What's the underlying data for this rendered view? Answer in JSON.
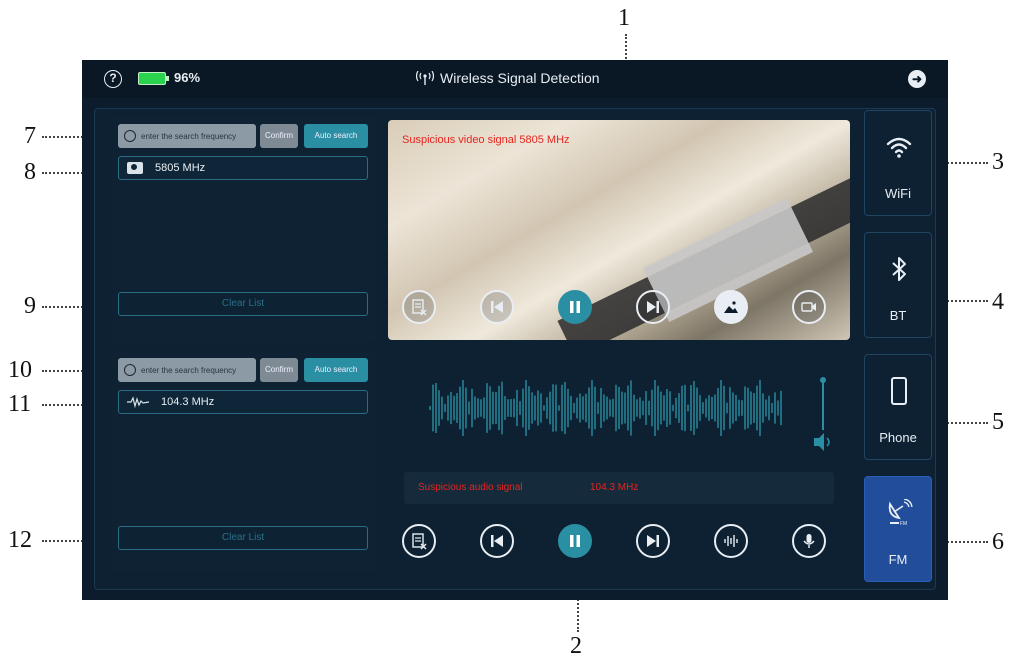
{
  "callouts": [
    "1",
    "2",
    "3",
    "4",
    "5",
    "6",
    "7",
    "8",
    "9",
    "10",
    "11",
    "12"
  ],
  "statusbar": {
    "help_glyph": "?",
    "battery_text": "96%",
    "title": "Wireless Signal Detection",
    "exit_glyph": "➜"
  },
  "video_list": {
    "search_placeholder": "enter the search frequency",
    "confirm_label": "Confirm",
    "auto_search_label": "Auto search",
    "entries": [
      {
        "frequency": "5805 MHz"
      }
    ],
    "clear_label": "Clear List"
  },
  "audio_list": {
    "search_placeholder": "enter the search frequency",
    "confirm_label": "Confirm",
    "auto_search_label": "Auto search",
    "entries": [
      {
        "frequency": "104.3 MHz"
      }
    ],
    "clear_label": "Clear List"
  },
  "video_view": {
    "alert_text": "Suspicious video signal 5805 MHz"
  },
  "audio_view": {
    "alert_label": "Suspicious audio signal",
    "alert_frequency": "104.3 MHz"
  },
  "modes": {
    "wifi": "WiFi",
    "bt": "BT",
    "phone": "Phone",
    "fm": "FM"
  },
  "colors": {
    "accent": "#2a8fa2",
    "alert": "#e8241e",
    "fm_active": "#214d9a"
  },
  "icons": {
    "video_controls": [
      "clear-list-icon",
      "previous-icon",
      "pause-icon",
      "next-icon",
      "snapshot-icon",
      "record-video-icon"
    ],
    "audio_controls": [
      "clear-list-icon",
      "previous-icon",
      "pause-icon",
      "next-icon",
      "audio-wave-icon",
      "microphone-icon"
    ]
  }
}
